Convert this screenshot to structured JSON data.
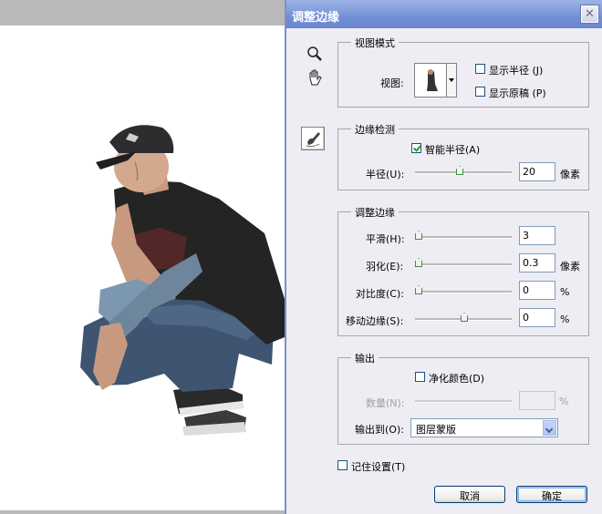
{
  "dialog": {
    "title": "调整边缘",
    "close_glyph": "✕",
    "tools": [
      {
        "name": "zoom-tool",
        "icon": "magnifier-icon",
        "glyph": "🔍"
      },
      {
        "name": "hand-tool",
        "icon": "hand-icon",
        "glyph": "✋"
      },
      {
        "name": "refine-radius-tool",
        "icon": "brush-icon"
      }
    ],
    "view_mode": {
      "title": "视图模式",
      "view_label": "视图:",
      "show_radius": {
        "label": "显示半径 (J)",
        "checked": false
      },
      "show_original": {
        "label": "显示原稿 (P)",
        "checked": false
      }
    },
    "edge_detection": {
      "title": "边缘检测",
      "smart_radius": {
        "label": "智能半径(A)",
        "checked": true
      },
      "radius": {
        "label": "半径(U):",
        "value": "20",
        "unit": "像素",
        "slider_fraction": 0.47
      }
    },
    "adjust_edge": {
      "title": "调整边缘",
      "smooth": {
        "label": "平滑(H):",
        "value": "3",
        "unit": "",
        "slider_fraction": 0.0
      },
      "feather": {
        "label": "羽化(E):",
        "value": "0.3",
        "unit": "像素",
        "slider_fraction": 0.0
      },
      "contrast": {
        "label": "对比度(C):",
        "value": "0",
        "unit": "%",
        "slider_fraction": 0.0
      },
      "shift_edge": {
        "label": "移动边缘(S):",
        "value": "0",
        "unit": "%",
        "slider_fraction": 0.5
      }
    },
    "output": {
      "title": "输出",
      "decontaminate": {
        "label": "净化颜色(D)",
        "checked": false
      },
      "amount": {
        "label": "数量(N):",
        "value": "",
        "unit": "%",
        "disabled": true
      },
      "output_to": {
        "label": "输出到(O):",
        "selected": "图层蒙版"
      }
    },
    "remember": {
      "label": "记住设置(T)",
      "checked": false
    },
    "cancel_label": "取消",
    "ok_label": "确定"
  },
  "colors": {
    "title_bar": "#7390d6",
    "dialog_bg": "#eeedf3",
    "check_mark": "#21a121",
    "slider_knob_border": "#3f8f3f"
  }
}
